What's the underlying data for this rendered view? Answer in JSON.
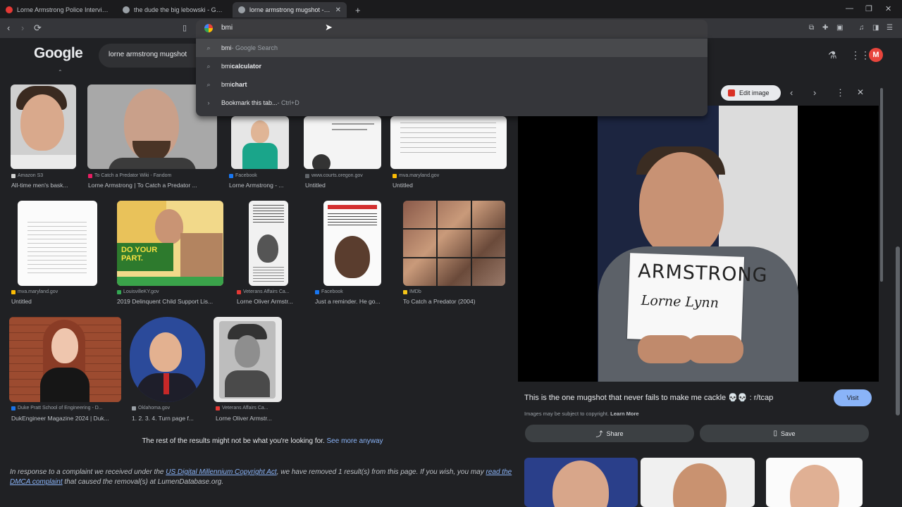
{
  "tabs": [
    {
      "title": "Lorne Armstrong Police Interview (T...",
      "favicon_color": "#e53935"
    },
    {
      "title": "the dude the big lebowski - Google",
      "favicon_color": "#9aa0a6"
    },
    {
      "title": "lorne armstrong mugshot - Goo",
      "favicon_color": "#9aa0a6"
    }
  ],
  "new_tab_icon": "+",
  "omnibox": {
    "value": "bmi"
  },
  "suggestions": [
    {
      "bold": "bmi",
      "rest": " - Google Search",
      "icon": "search-icon"
    },
    {
      "bold": "bmi ",
      "rest": "calculator",
      "icon": "search-icon"
    },
    {
      "bold": "bmi ",
      "rest": "chart",
      "icon": "search-icon"
    },
    {
      "bold": "Bookmark this tab...",
      "rest": " - Ctrl+D",
      "icon": "arrow-icon"
    }
  ],
  "google": {
    "logo": "Google",
    "query": "lorne armstrong mugshot",
    "avatar_letter": "M"
  },
  "results": [
    {
      "source": "Amazon S3",
      "caption": "All-time men's bask...",
      "src_color": "#d2d2d2"
    },
    {
      "source": "To Catch a Predator Wiki - Fandom",
      "caption": "Lorne Armstrong | To Catch a Predator ...",
      "src_color": "#e91e63"
    },
    {
      "source": "Facebook",
      "caption": "Lorne Armstrong - ...",
      "src_color": "#1877f2"
    },
    {
      "source": "www.courts.oregon.gov",
      "caption": "Untitled",
      "src_color": "#5f6368"
    },
    {
      "source": "mva.maryland.gov",
      "caption": "Untitled",
      "src_color": "#fbbc05"
    },
    {
      "source": "mva.maryland.gov",
      "caption": "Untitled",
      "src_color": "#fbbc05"
    },
    {
      "source": "LouisvilleKY.gov",
      "caption": "2019 Delinquent Child Support Lis...",
      "src_color": "#34a853"
    },
    {
      "source": "Veterans Affairs Ca...",
      "caption": "Lorne Oliver Armstr...",
      "src_color": "#e53935"
    },
    {
      "source": "Facebook",
      "caption": "Just a reminder. He go...",
      "src_color": "#1877f2"
    },
    {
      "source": "IMDb",
      "caption": "To Catch a Predator (2004)",
      "src_color": "#f5c518"
    },
    {
      "source": "Duke Pratt School of Engineering - D...",
      "caption": "DukEngineer Magazine 2024 | Duk...",
      "src_color": "#1a73e8"
    },
    {
      "source": "Oklahoma.gov",
      "caption": "1. 2. 3. 4. Turn page f...",
      "src_color": "#9aa0a6"
    },
    {
      "source": "Veterans Affairs Ca...",
      "caption": "Lorne Oliver Armstr...",
      "src_color": "#e53935"
    }
  ],
  "more": {
    "text": "The rest of the results might not be what you're looking for. ",
    "link": "See more anyway"
  },
  "dmca": {
    "t1": "In response to a complaint we received under the ",
    "link1": "US Digital Millennium Copyright Act",
    "t2": ", we have removed 1 result(s) from this page. If you wish, you may ",
    "link2": "read the DMCA complaint",
    "t3": " that caused the removal(s) at LumenDatabase.org."
  },
  "panel": {
    "edit_label": "Edit image",
    "sign_line1": "ARMSTRONG",
    "sign_line2": "Lorne  Lynn",
    "title": "This is the one mugshot that never fails to make me cackle 💀💀 : r/tcap",
    "visit": "Visit",
    "copyright": "Images may be subject to copyright.",
    "learn_more": "Learn More",
    "share": "Share",
    "save": "Save"
  },
  "colors": {
    "accent": "#8ab4f8",
    "page_bg": "#202124",
    "avatar": "#e8453c"
  }
}
